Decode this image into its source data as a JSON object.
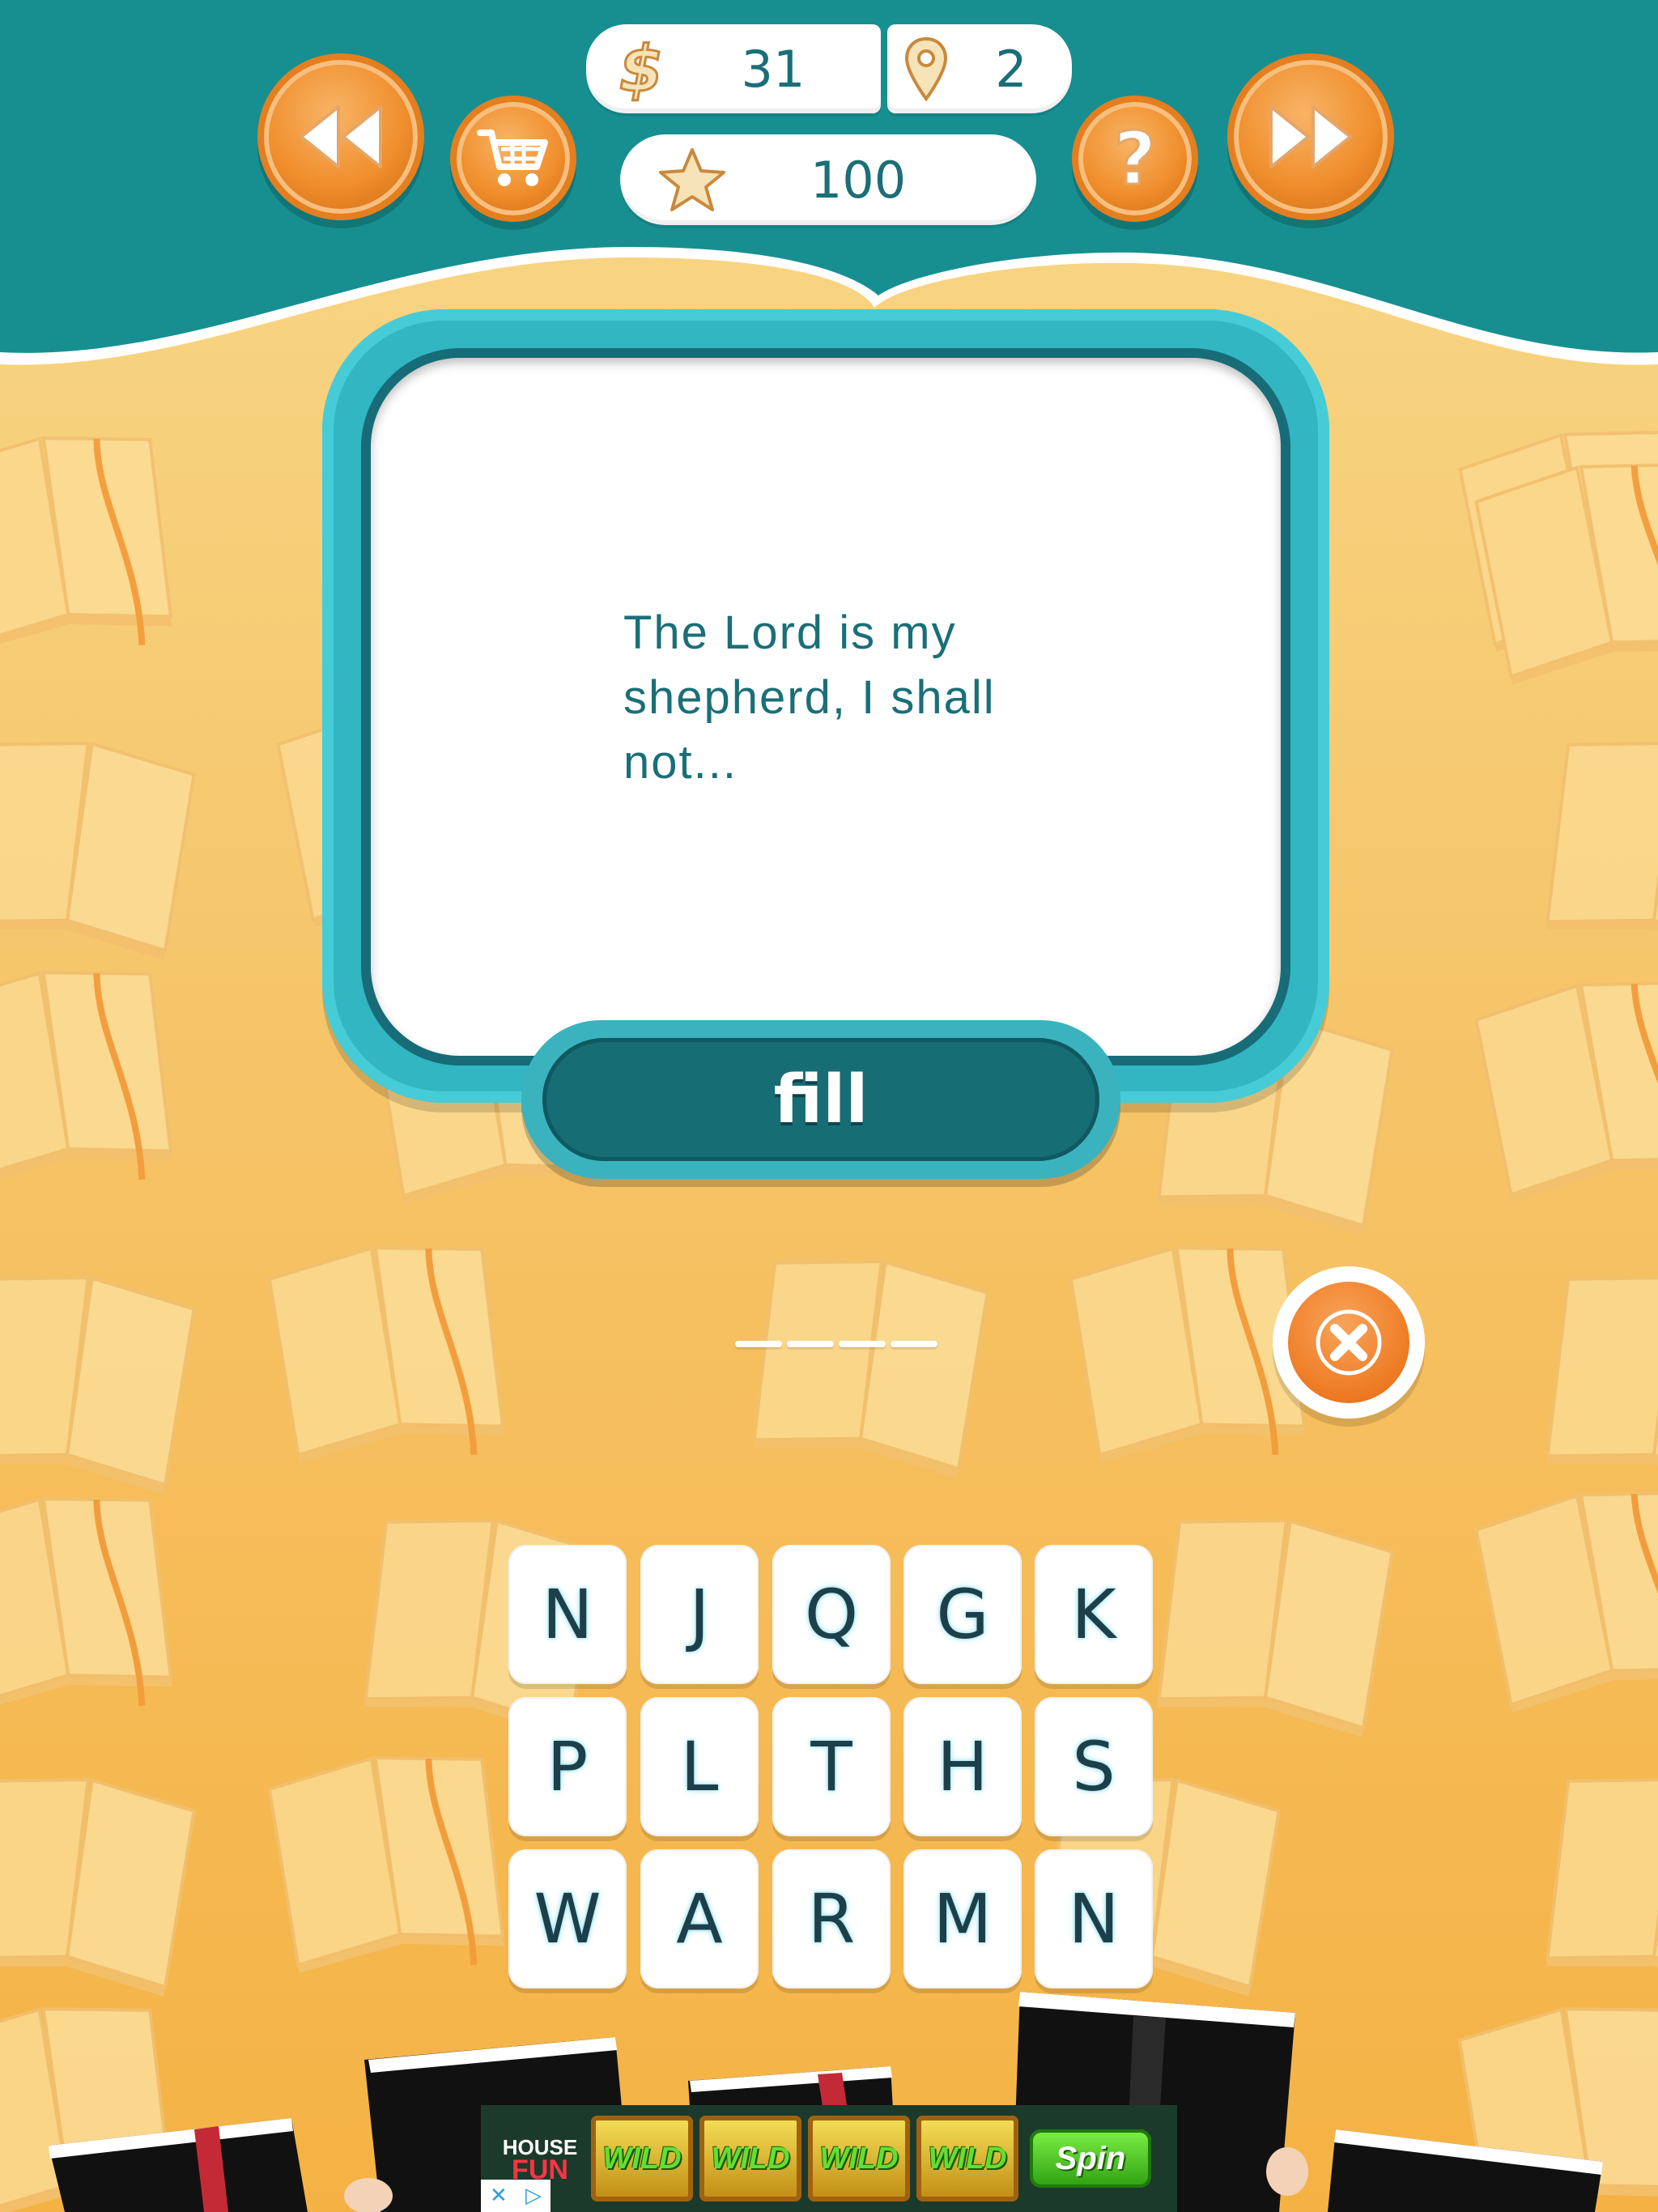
{
  "stats": {
    "coins": "31",
    "level": "2",
    "stars": "100"
  },
  "icons": {
    "back": "rewind-icon",
    "shop": "shopping-cart-icon",
    "help": "question-icon",
    "skip": "fast-forward-icon",
    "coin": "dollar-icon",
    "level": "map-pin-icon",
    "stars": "star-icon",
    "clear": "close-icon"
  },
  "puzzle": {
    "clue": "The Lord is my shepherd, I shall not...",
    "category_label": "fill",
    "answer_length": 4
  },
  "letters": [
    [
      "N",
      "J",
      "Q",
      "G",
      "K"
    ],
    [
      "P",
      "L",
      "T",
      "H",
      "S"
    ],
    [
      "W",
      "A",
      "R",
      "M",
      "N"
    ]
  ],
  "ad": {
    "logo_line1": "HOUSE",
    "logo_line2": "FUN",
    "reels": [
      "WILD",
      "WILD",
      "WILD",
      "WILD"
    ],
    "cta": "Spin"
  },
  "colors": {
    "header_teal": "#178f91",
    "button_orange": "#f08e2c",
    "card_border": "#31b6c2",
    "fill_button": "#176d74",
    "clue_text": "#1a6f78",
    "background_top": "#f8d98a",
    "background_bottom": "#f5b244"
  }
}
